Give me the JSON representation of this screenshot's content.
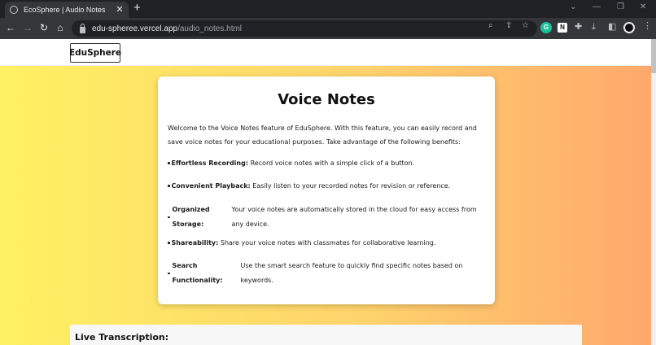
{
  "browser": {
    "tab_title": "EcoSphere | Audio Notes",
    "tab_close": "✕",
    "new_tab": "+",
    "url_host": "edu-spheree.vercel.app",
    "url_path": "/audio_notes.html",
    "window_buttons": {
      "minimize": "—",
      "restore": "❐",
      "close": "✕"
    },
    "nav": {
      "back": "←",
      "forward": "→",
      "reload": "↻",
      "home": "⌂"
    },
    "extension_labels": {
      "grammarly": "G",
      "notion": "N"
    }
  },
  "page": {
    "logo": "EduSphere",
    "card": {
      "title": "Voice Notes",
      "intro": "Welcome to the Voice Notes feature of EduSphere. With this feature, you can easily record and save voice notes for your educational purposes. Take advantage of the following benefits:",
      "benefits": [
        {
          "label": "Effortless Recording:",
          "desc": "Record voice notes with a simple click of a button."
        },
        {
          "label": "Convenient Playback:",
          "desc": "Easily listen to your recorded notes for revision or reference."
        },
        {
          "label": "Organized Storage:",
          "desc": "Your voice notes are automatically stored in the cloud for easy access from any device."
        },
        {
          "label": "Shareability:",
          "desc": "Share your voice notes with classmates for collaborative learning."
        },
        {
          "label": "Search Functionality:",
          "desc": "Use the smart search feature to quickly find specific notes based on keywords."
        }
      ]
    },
    "transcription_title": "Live Transcription:"
  },
  "colors": {
    "gradient_start": "#fef162",
    "gradient_end": "#fea76c",
    "chrome_dark": "#202124",
    "chrome_mid": "#35363a"
  }
}
